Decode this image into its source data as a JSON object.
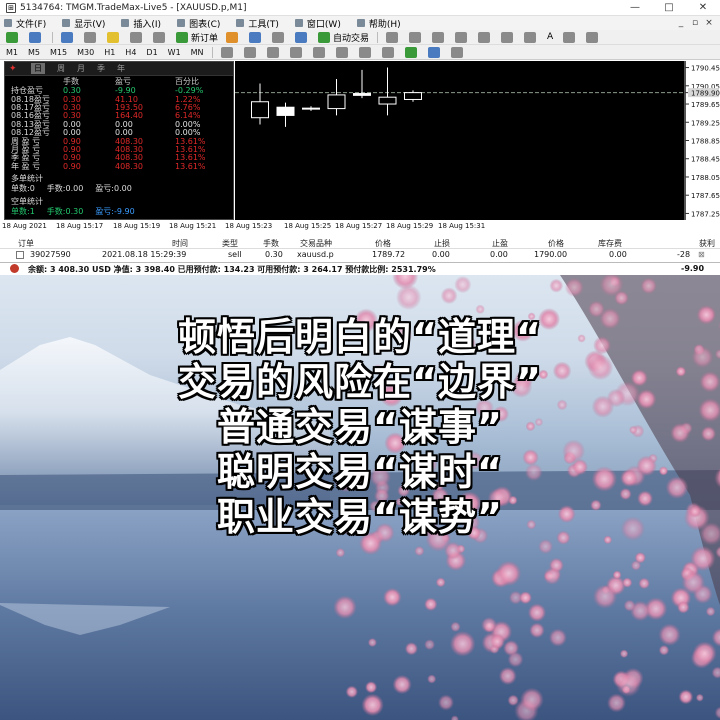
{
  "window": {
    "title": "5134764: TMGM.TradeMax-Live5 - [XAUUSD.p,M1]",
    "controls": [
      "—",
      "□",
      "✕"
    ]
  },
  "menu": {
    "items": [
      "文件(F)",
      "显示(V)",
      "插入(I)",
      "图表(C)",
      "工具(T)",
      "窗口(W)",
      "帮助(H)"
    ],
    "mdi_controls": [
      "_",
      "▫",
      "×"
    ]
  },
  "toolbar": {
    "new_order": "新订单",
    "auto_trading": "自动交易",
    "text_tool": "A",
    "timeframes": [
      "M1",
      "M5",
      "M15",
      "M30",
      "H1",
      "H4",
      "D1",
      "W1",
      "MN"
    ]
  },
  "terminal": {
    "period_tabs": [
      "日",
      "周",
      "月",
      "季",
      "年"
    ],
    "columns": [
      "手数",
      "盈亏",
      "百分比"
    ],
    "rows": [
      {
        "label": "持仓盈亏",
        "lots": "0.30",
        "pl": "-9.90",
        "pct": "-0.29%",
        "lots_color": "pos",
        "pl_color": "pos",
        "pct_color": "pos"
      },
      {
        "label": "08.18盈亏",
        "lots": "0.30",
        "pl": "41.10",
        "pct": "1.22%",
        "lots_color": "neg",
        "pl_color": "neg",
        "pct_color": "neg"
      },
      {
        "label": "08.17盈亏",
        "lots": "0.30",
        "pl": "193.50",
        "pct": "6.76%",
        "lots_color": "neg",
        "pl_color": "neg",
        "pct_color": "neg"
      },
      {
        "label": "08.16盈亏",
        "lots": "0.30",
        "pl": "164.40",
        "pct": "6.14%",
        "lots_color": "neg",
        "pl_color": "neg",
        "pct_color": "neg"
      },
      {
        "label": "08.13盈亏",
        "lots": "0.00",
        "pl": "0.00",
        "pct": "0.00%",
        "lots_color": "wht",
        "pl_color": "wht",
        "pct_color": "wht"
      },
      {
        "label": "08.12盈亏",
        "lots": "0.00",
        "pl": "0.00",
        "pct": "0.00%",
        "lots_color": "wht",
        "pl_color": "wht",
        "pct_color": "wht"
      },
      {
        "label": "周 盈 亏",
        "lots": "0.90",
        "pl": "408.30",
        "pct": "13.61%",
        "lots_color": "neg",
        "pl_color": "neg",
        "pct_color": "neg"
      },
      {
        "label": "月 盈 亏",
        "lots": "0.90",
        "pl": "408.30",
        "pct": "13.61%",
        "lots_color": "neg",
        "pl_color": "neg",
        "pct_color": "neg"
      },
      {
        "label": "季 盈 亏",
        "lots": "0.90",
        "pl": "408.30",
        "pct": "13.61%",
        "lots_color": "neg",
        "pl_color": "neg",
        "pct_color": "neg"
      },
      {
        "label": "年 盈 亏",
        "lots": "0.90",
        "pl": "408.30",
        "pct": "13.61%",
        "lots_color": "neg",
        "pl_color": "neg",
        "pct_color": "neg"
      }
    ],
    "long_title": "多单统计",
    "long_line": [
      "单数:0",
      "手数:0.00",
      "盈亏:0.00"
    ],
    "short_title": "空单统计",
    "short_line": [
      "单数:1",
      "手数:0.30",
      "盈亏:-9.90"
    ]
  },
  "chart_data": {
    "type": "candlestick",
    "symbol": "XAUUSD.p",
    "timeframe": "M1",
    "y_ticks": [
      "1790.45",
      "1790.05",
      "1789.90",
      "1789.65",
      "1789.25",
      "1788.85",
      "1788.45",
      "1788.05",
      "1787.65",
      "1787.25"
    ],
    "current_price": 1789.9,
    "ylim": [
      1787.15,
      1790.55
    ],
    "x_ticks": [
      "18 Aug 2021",
      "18 Aug 15:17",
      "18 Aug 15:19",
      "18 Aug 15:21",
      "18 Aug 15:23",
      "18 Aug 15:25",
      "18 Aug 15:27",
      "18 Aug 15:29",
      "18 Aug 15:31"
    ],
    "candles": [
      {
        "open": 1789.35,
        "high": 1790.1,
        "low": 1789.2,
        "close": 1789.7
      },
      {
        "open": 1789.58,
        "high": 1789.68,
        "low": 1789.15,
        "close": 1789.4
      },
      {
        "open": 1789.55,
        "high": 1789.6,
        "low": 1789.5,
        "close": 1789.56
      },
      {
        "open": 1789.55,
        "high": 1790.2,
        "low": 1789.4,
        "close": 1789.85
      },
      {
        "open": 1789.88,
        "high": 1790.4,
        "low": 1789.78,
        "close": 1789.84
      },
      {
        "open": 1789.65,
        "high": 1790.45,
        "low": 1789.4,
        "close": 1789.8
      },
      {
        "open": 1789.75,
        "high": 1789.95,
        "low": 1789.7,
        "close": 1789.9
      }
    ],
    "colors": {
      "background": "#000000",
      "wick": "#ffffff",
      "body": "#ffffff",
      "grid": "#556655",
      "price_line": "#8a9a8a"
    }
  },
  "trades": {
    "columns": [
      "订单",
      "时间",
      "类型",
      "手数",
      "交易品种",
      "价格",
      "止损",
      "止盈",
      "价格",
      "库存费",
      "获利"
    ],
    "row": {
      "order": "39027590",
      "time": "2021.08.18 15:29:39",
      "type": "sell",
      "lots": "0.30",
      "symbol": "xauusd.p",
      "open_price": "1789.72",
      "sl": "0.00",
      "tp": "0.00",
      "price": "1790.00",
      "swap": "0.00",
      "profit": "-28"
    },
    "balance_line": "余额: 3 408.30 USD  净值: 3 398.40  已用预付款: 134.23  可用预付款: 3 264.17  预付款比例: 2531.79%",
    "total_profit": "-9.90"
  },
  "quote": {
    "lines": [
      "顿悟后明白的“道理“",
      "交易的风险在“边界”",
      "普通交易“谋事”",
      "聪明交易“谋时“",
      "职业交易“谋势”"
    ]
  }
}
